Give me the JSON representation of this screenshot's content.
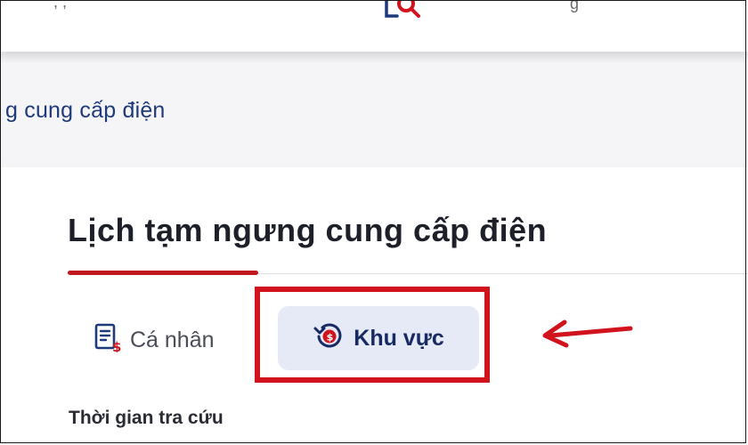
{
  "header": {
    "left_partial": ", ,",
    "right_partial": "g"
  },
  "breadcrumb": {
    "text": "g cung cấp điện"
  },
  "page": {
    "title": "Lịch tạm ngưng cung cấp điện"
  },
  "tabs": [
    {
      "label": "Cá nhân",
      "icon": "invoice-dollar-icon",
      "active": false
    },
    {
      "label": "Khu vực",
      "icon": "history-dollar-icon",
      "active": true
    }
  ],
  "form": {
    "time_label": "Thời gian tra cứu"
  },
  "colors": {
    "accent_red": "#c0181f",
    "highlight_red": "#d0131c",
    "navy": "#1f3a7a",
    "active_tab_bg": "#e6e9f6"
  }
}
